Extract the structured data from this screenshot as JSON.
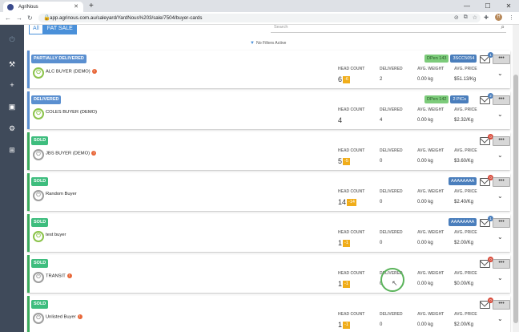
{
  "browser": {
    "tab_title": "AgriNous",
    "url": "app.agrinous.com.au/saleyard/YardNous%203/sale/7504/buyer-cards",
    "profile_initial": "H"
  },
  "filters": {
    "all_label": "All",
    "fat_sale_label": "FAT SALE",
    "search_placeholder": "Search",
    "no_filters_label": "No Filters Active"
  },
  "columns": {
    "head": "HEAD COUNT",
    "delivered": "DELIVERED",
    "avg_weight": "AVG. WEIGHT",
    "avg_price": "AVG. PRICE"
  },
  "more_label": "•••",
  "cards": [
    {
      "status": "PARTIALLY DELIVERED",
      "status_color": "blue",
      "buyer": "ALC BUYER (DEMO)",
      "info": true,
      "head": "6",
      "warn": "-6",
      "delivered": "2",
      "weight": "0.00 kg",
      "price": "$51.13/Kg",
      "badges": [
        "DPen 143",
        "3SCC5054"
      ],
      "badge_styles": [
        "lg",
        "b"
      ],
      "notif": "1",
      "notif_color": "blue",
      "power": "green"
    },
    {
      "status": "DELIVERED",
      "status_color": "blue",
      "buyer": "COLES BUYER (DEMO)",
      "info": false,
      "head": "4",
      "warn": "",
      "delivered": "4",
      "weight": "0.00 kg",
      "price": "$2.32/Kg",
      "badges": [
        "DPen 142",
        "2 PICs"
      ],
      "badge_styles": [
        "lg",
        "b"
      ],
      "notif": "2",
      "notif_color": "blue",
      "power": "green"
    },
    {
      "status": "SOLD",
      "status_color": "green",
      "buyer": "JBS BUYER (DEMO)",
      "info": true,
      "head": "5",
      "warn": "-5",
      "delivered": "0",
      "weight": "0.00 kg",
      "price": "$3.60/Kg",
      "badges": [],
      "badge_styles": [],
      "notif": "0",
      "notif_color": "red",
      "power": "grey"
    },
    {
      "status": "SOLD",
      "status_color": "green",
      "buyer": "Random Buyer",
      "info": false,
      "head": "14",
      "warn": "-14",
      "delivered": "0",
      "weight": "0.00 kg",
      "price": "$2.40/Kg",
      "badges": [
        "AAAAAAAA"
      ],
      "badge_styles": [
        "b"
      ],
      "notif": "0",
      "notif_color": "red",
      "power": "grey"
    },
    {
      "status": "SOLD",
      "status_color": "green",
      "buyer": "test buyer",
      "info": false,
      "head": "1",
      "warn": "-1",
      "delivered": "0",
      "weight": "0.00 kg",
      "price": "$2.00/Kg",
      "badges": [
        "AAAAAAAA"
      ],
      "badge_styles": [
        "b"
      ],
      "notif": "1",
      "notif_color": "blue",
      "power": "green"
    },
    {
      "status": "SOLD",
      "status_color": "green",
      "buyer": "TRANSIT",
      "info": true,
      "head": "1",
      "warn": "-1",
      "delivered": "0",
      "weight": "0.00 kg",
      "price": "$0.00/Kg",
      "badges": [],
      "badge_styles": [],
      "notif": "0",
      "notif_color": "red",
      "power": "grey"
    },
    {
      "status": "SOLD",
      "status_color": "green",
      "buyer": "Unlisted Buyer",
      "info": true,
      "head": "1",
      "warn": "-1",
      "delivered": "0",
      "weight": "0.00 kg",
      "price": "$2.00/Kg",
      "badges": [],
      "badge_styles": [],
      "notif": "0",
      "notif_color": "red",
      "power": "grey"
    }
  ],
  "colors": {
    "sidebar": "#3f4a5a",
    "accent": "#4a90d9",
    "sold_green": "#3ebd7e",
    "delivered_blue": "#5a8fd0",
    "warn": "#f0ad1a"
  },
  "icons": {
    "sidebar": [
      "power-icon",
      "gavel-icon",
      "plus-icon",
      "id-card-icon",
      "users-cog-icon",
      "money-icon"
    ]
  }
}
